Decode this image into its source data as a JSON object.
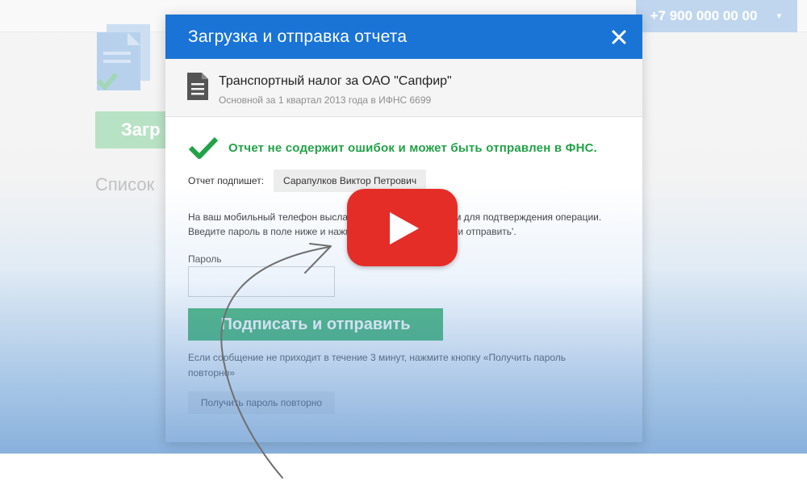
{
  "background": {
    "phone_number": "+7 900 000 00 00",
    "upload_button_partial": "Загр",
    "list_label_partial": "Список"
  },
  "modal": {
    "title": "Загрузка и отправка отчета",
    "report": {
      "name": "Транспортный налог за ОАО \"Сапфир\"",
      "subtitle": "Основной за 1 квартал 2013 года в ИФНС 6699"
    },
    "status_message": "Отчет не содержит ошибок и может быть отправлен в ФНС.",
    "signer": {
      "label": "Отчет подпишет:",
      "name": "Сарапулков Виктор Петрович"
    },
    "info_text": "На ваш мобильный телефон выслано сообщение с паролем для подтверждения операции. Введите пароль в поле ниже и нажмите кнопку «Подписать и отправить'.",
    "password": {
      "label": "Пароль",
      "value": "",
      "placeholder": ""
    },
    "submit_label": "Подписать и отправить",
    "hint_text": "Если сообщение не приходит в течение 3 минут, нажмите кнопку «Получить пароль повторно»",
    "resend_label": "Получить пароль повторно"
  },
  "colors": {
    "header_blue": "#1a74d6",
    "success_green": "#22a247",
    "button_green": "#22a85a",
    "play_red": "#e52d27"
  },
  "icons": {
    "close": "close-icon",
    "document": "document-icon",
    "check": "check-icon",
    "play": "play-icon"
  }
}
